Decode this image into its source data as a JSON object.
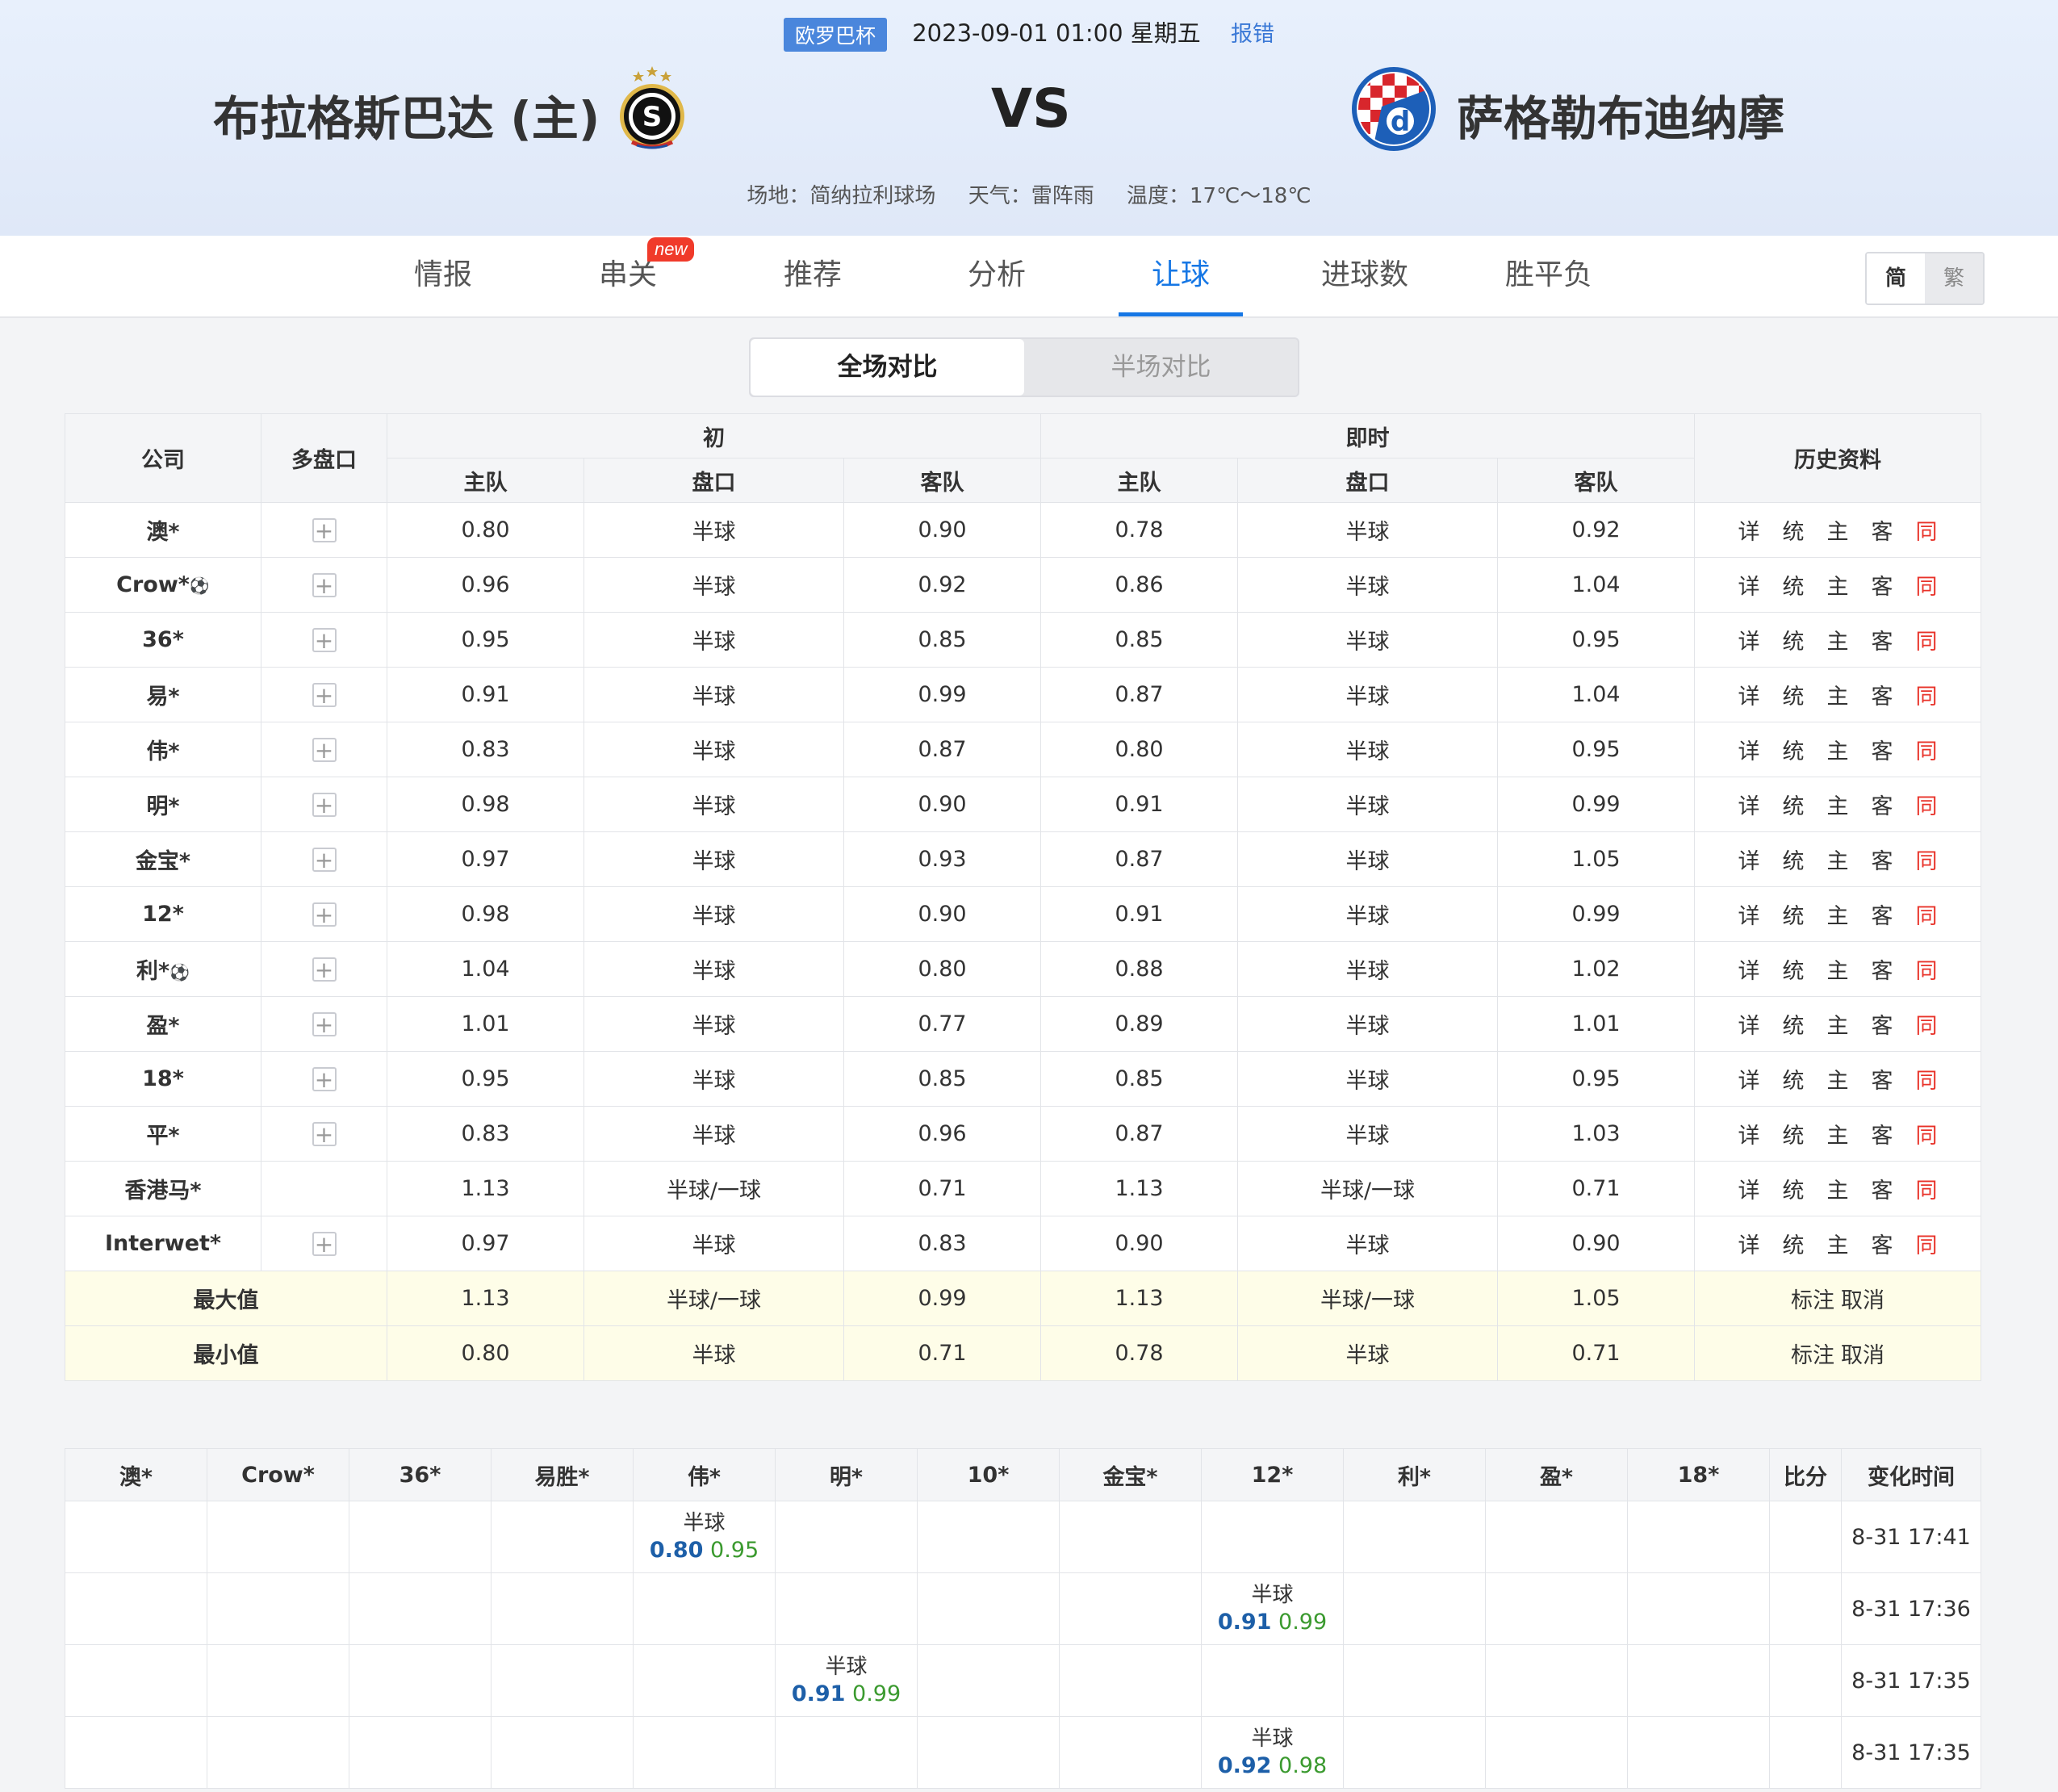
{
  "header": {
    "league": "欧罗巴杯",
    "datetime": "2023-09-01 01:00 星期五",
    "report": "报错",
    "home_team": "布拉格斯巴达 (主)",
    "vs": "VS",
    "away_team": "萨格勒布迪纳摩",
    "venue": "场地：简纳拉利球场",
    "weather": "天气：雷阵雨",
    "temperature": "温度：17℃～18℃"
  },
  "tabs": [
    {
      "label": "情报"
    },
    {
      "label": "串关",
      "badge": "new"
    },
    {
      "label": "推荐"
    },
    {
      "label": "分析"
    },
    {
      "label": "让球",
      "active": true
    },
    {
      "label": "进球数"
    },
    {
      "label": "胜平负"
    }
  ],
  "lang": {
    "simplified": "简",
    "traditional": "繁"
  },
  "segmented": {
    "full": "全场对比",
    "half": "半场对比"
  },
  "odds_table": {
    "headers": {
      "company": "公司",
      "multi": "多盘口",
      "initial": "初",
      "live": "即时",
      "history": "历史资料",
      "home": "主队",
      "line": "盘口",
      "away": "客队"
    },
    "history_links": [
      "详",
      "统",
      "主",
      "客",
      "同"
    ],
    "rows": [
      {
        "company": "澳*",
        "plus": true,
        "ball": false,
        "i_home": "0.80",
        "i_line": "半球",
        "i_away": "0.90",
        "l_home": "0.78",
        "l_line": "半球",
        "l_away": "0.92"
      },
      {
        "company": "Crow*",
        "plus": true,
        "ball": true,
        "i_home": "0.96",
        "i_line": "半球",
        "i_away": "0.92",
        "l_home": "0.86",
        "l_line": "半球",
        "l_away": "1.04"
      },
      {
        "company": "36*",
        "plus": true,
        "ball": false,
        "i_home": "0.95",
        "i_line": "半球",
        "i_away": "0.85",
        "l_home": "0.85",
        "l_line": "半球",
        "l_away": "0.95"
      },
      {
        "company": "易*",
        "plus": true,
        "ball": false,
        "i_home": "0.91",
        "i_line": "半球",
        "i_away": "0.99",
        "l_home": "0.87",
        "l_line": "半球",
        "l_away": "1.04"
      },
      {
        "company": "伟*",
        "plus": true,
        "ball": false,
        "i_home": "0.83",
        "i_line": "半球",
        "i_away": "0.87",
        "l_home": "0.80",
        "l_line": "半球",
        "l_away": "0.95"
      },
      {
        "company": "明*",
        "plus": true,
        "ball": false,
        "i_home": "0.98",
        "i_line": "半球",
        "i_away": "0.90",
        "l_home": "0.91",
        "l_line": "半球",
        "l_away": "0.99"
      },
      {
        "company": "金宝*",
        "plus": true,
        "ball": false,
        "i_home": "0.97",
        "i_line": "半球",
        "i_away": "0.93",
        "l_home": "0.87",
        "l_line": "半球",
        "l_away": "1.05"
      },
      {
        "company": "12*",
        "plus": true,
        "ball": false,
        "i_home": "0.98",
        "i_line": "半球",
        "i_away": "0.90",
        "l_home": "0.91",
        "l_line": "半球",
        "l_away": "0.99"
      },
      {
        "company": "利*",
        "plus": true,
        "ball": true,
        "i_home": "1.04",
        "i_line": "半球",
        "i_away": "0.80",
        "l_home": "0.88",
        "l_line": "半球",
        "l_away": "1.02"
      },
      {
        "company": "盈*",
        "plus": true,
        "ball": false,
        "i_home": "1.01",
        "i_line": "半球",
        "i_away": "0.77",
        "l_home": "0.89",
        "l_line": "半球",
        "l_away": "1.01"
      },
      {
        "company": "18*",
        "plus": true,
        "ball": false,
        "i_home": "0.95",
        "i_line": "半球",
        "i_away": "0.85",
        "l_home": "0.85",
        "l_line": "半球",
        "l_away": "0.95"
      },
      {
        "company": "平*",
        "plus": true,
        "ball": false,
        "i_home": "0.83",
        "i_line": "半球",
        "i_away": "0.96",
        "l_home": "0.87",
        "l_line": "半球",
        "l_away": "1.03"
      },
      {
        "company": "香港马*",
        "plus": false,
        "ball": false,
        "i_home": "1.13",
        "i_line": "半球/一球",
        "i_away": "0.71",
        "l_home": "1.13",
        "l_line": "半球/一球",
        "l_away": "0.71"
      },
      {
        "company": "Interwet*",
        "plus": true,
        "ball": false,
        "i_home": "0.97",
        "i_line": "半球",
        "i_away": "0.83",
        "l_home": "0.90",
        "l_line": "半球",
        "l_away": "0.90"
      }
    ],
    "summary": [
      {
        "label": "最大值",
        "i_home": "1.13",
        "i_line": "半球/一球",
        "i_away": "0.99",
        "l_home": "1.13",
        "l_line": "半球/一球",
        "l_away": "1.05",
        "mark": "标注",
        "cancel": "取消"
      },
      {
        "label": "最小值",
        "i_home": "0.80",
        "i_line": "半球",
        "i_away": "0.71",
        "l_home": "0.78",
        "l_line": "半球",
        "l_away": "0.71",
        "mark": "标注",
        "cancel": "取消"
      }
    ]
  },
  "change_table": {
    "headers": [
      "澳*",
      "Crow*",
      "36*",
      "易胜*",
      "伟*",
      "明*",
      "10*",
      "金宝*",
      "12*",
      "利*",
      "盈*",
      "18*",
      "比分",
      "变化时间"
    ],
    "rows": [
      {
        "col": 4,
        "line": "半球",
        "home": "0.80",
        "away": "0.95",
        "time": "8-31 17:41"
      },
      {
        "col": 8,
        "line": "半球",
        "home": "0.91",
        "away": "0.99",
        "time": "8-31 17:36"
      },
      {
        "col": 5,
        "line": "半球",
        "home": "0.91",
        "away": "0.99",
        "time": "8-31 17:35"
      },
      {
        "col": 8,
        "line": "半球",
        "home": "0.92",
        "away": "0.98",
        "time": "8-31 17:35"
      }
    ]
  }
}
